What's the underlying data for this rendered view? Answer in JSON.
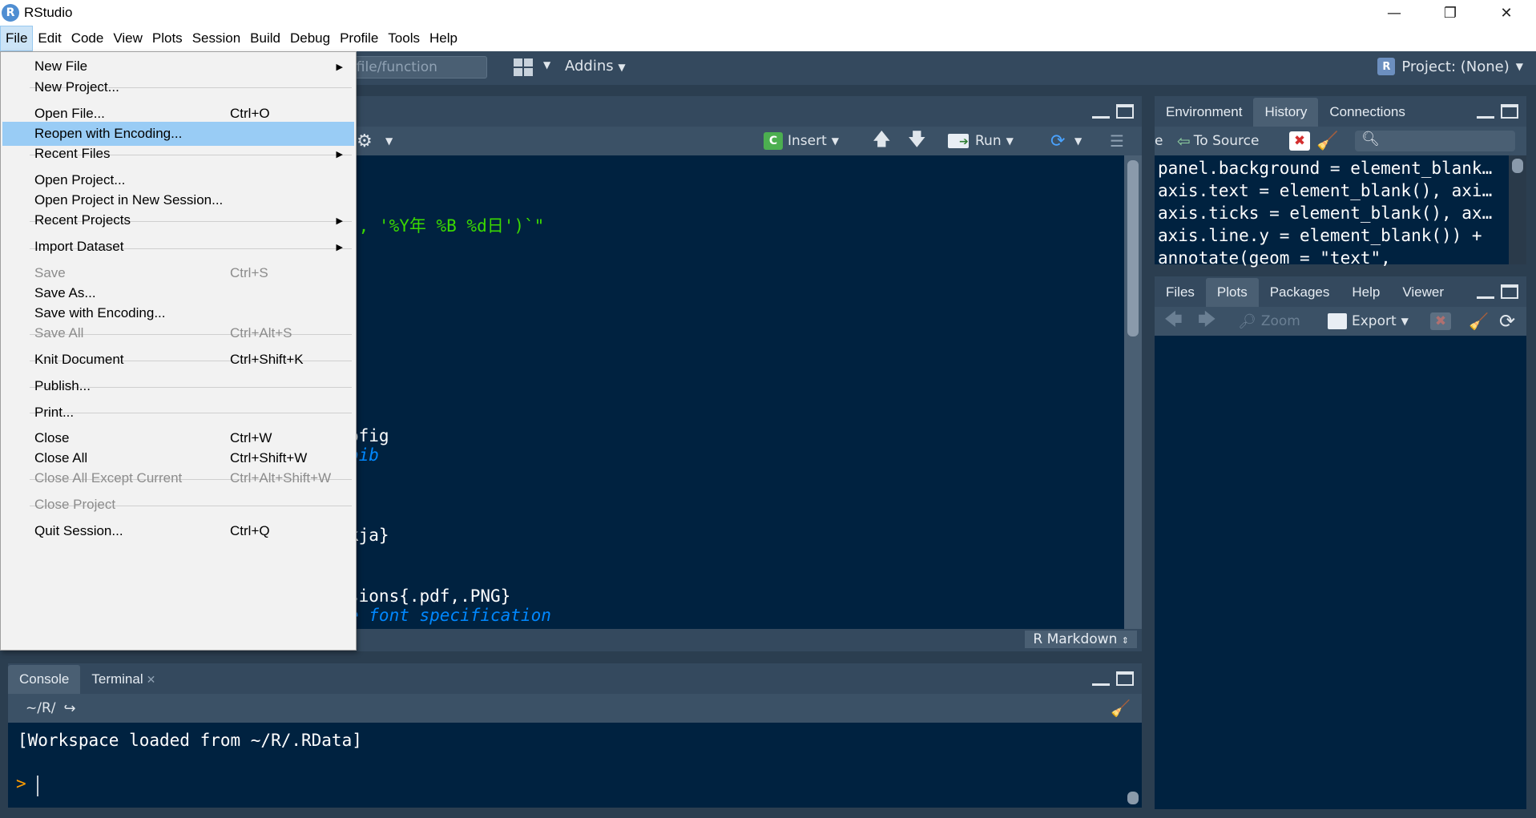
{
  "window": {
    "title": "RStudio",
    "logo_letter": "R",
    "minimize": "—",
    "restore": "❐",
    "close": "✕"
  },
  "menubar": [
    "File",
    "Edit",
    "Code",
    "View",
    "Plots",
    "Session",
    "Build",
    "Debug",
    "Profile",
    "Tools",
    "Help"
  ],
  "toolbar": {
    "goto_placeholder": "o file/function",
    "addins": "Addins",
    "project": "Project: (None)",
    "project_icon": "R"
  },
  "file_menu": {
    "items": [
      {
        "label": "New File",
        "shortcut": "",
        "submenu": true,
        "disabled": false
      },
      {
        "label": "New Project...",
        "shortcut": "",
        "submenu": false,
        "disabled": false
      },
      {
        "label": "Open File...",
        "shortcut": "Ctrl+O",
        "submenu": false,
        "disabled": false
      },
      {
        "label": "Reopen with Encoding...",
        "shortcut": "",
        "submenu": false,
        "disabled": false
      },
      {
        "label": "Recent Files",
        "shortcut": "",
        "submenu": true,
        "disabled": false
      },
      {
        "label": "Open Project...",
        "shortcut": "",
        "submenu": false,
        "disabled": false
      },
      {
        "label": "Open Project in New Session...",
        "shortcut": "",
        "submenu": false,
        "disabled": false
      },
      {
        "label": "Recent Projects",
        "shortcut": "",
        "submenu": true,
        "disabled": false
      },
      {
        "label": "Import Dataset",
        "shortcut": "",
        "submenu": true,
        "disabled": false
      },
      {
        "label": "Save",
        "shortcut": "Ctrl+S",
        "submenu": false,
        "disabled": true
      },
      {
        "label": "Save As...",
        "shortcut": "",
        "submenu": false,
        "disabled": false
      },
      {
        "label": "Save with Encoding...",
        "shortcut": "",
        "submenu": false,
        "disabled": false
      },
      {
        "label": "Save All",
        "shortcut": "Ctrl+Alt+S",
        "submenu": false,
        "disabled": true
      },
      {
        "label": "Knit Document",
        "shortcut": "Ctrl+Shift+K",
        "submenu": false,
        "disabled": false
      },
      {
        "label": "Publish...",
        "shortcut": "",
        "submenu": false,
        "disabled": false
      },
      {
        "label": "Print...",
        "shortcut": "",
        "submenu": false,
        "disabled": false
      },
      {
        "label": "Close",
        "shortcut": "Ctrl+W",
        "submenu": false,
        "disabled": false
      },
      {
        "label": "Close All",
        "shortcut": "Ctrl+Shift+W",
        "submenu": false,
        "disabled": false
      },
      {
        "label": "Close All Except Current",
        "shortcut": "Ctrl+Alt+Shift+W",
        "submenu": false,
        "disabled": true
      },
      {
        "label": "Close Project",
        "shortcut": "",
        "submenu": false,
        "disabled": true
      },
      {
        "label": "Quit Session...",
        "shortcut": "Ctrl+Q",
        "submenu": false,
        "disabled": false
      }
    ],
    "hover_index": 3
  },
  "source": {
    "toolbar": {
      "insert": "Insert",
      "run": "Run"
    },
    "lines": [
      {
        "text": "), '%Y年 %B %d日')`\"",
        "style": "green"
      },
      {
        "text": "ofig",
        "style": "normal"
      },
      {
        "text": "bib",
        "style": "comment"
      },
      {
        "text": "kja}",
        "style": "normal"
      },
      {
        "text": "sions{.pdf,.PNG}",
        "style": "normal"
      },
      {
        "text": "e font specification",
        "style": "comment"
      }
    ],
    "mode": "R Markdown"
  },
  "env_pane": {
    "tabs": [
      "Environment",
      "History",
      "Connections"
    ],
    "selected_tab": "History",
    "to_source": "To Source",
    "history": [
      "panel.background = element_blank…",
      "axis.text = element_blank(), axi…",
      "axis.ticks = element_blank(), ax…",
      "axis.line.y = element_blank()) +",
      "annotate(geom = \"text\","
    ]
  },
  "files_pane": {
    "tabs": [
      "Files",
      "Plots",
      "Packages",
      "Help",
      "Viewer"
    ],
    "selected_tab": "Plots",
    "zoom": "Zoom",
    "export": "Export"
  },
  "console": {
    "tabs": [
      "Console",
      "Terminal"
    ],
    "selected_tab": "Console",
    "path": "~/R/",
    "output": "[Workspace loaded from ~/R/.RData]",
    "prompt": ">"
  },
  "colors": {
    "editor_bg": "#002240",
    "chrome": "#34495e",
    "menu_hover": "#99ccf5",
    "string_green": "#3ad900",
    "comment_blue": "#0088ff",
    "prompt_orange": "#ff9d00"
  }
}
